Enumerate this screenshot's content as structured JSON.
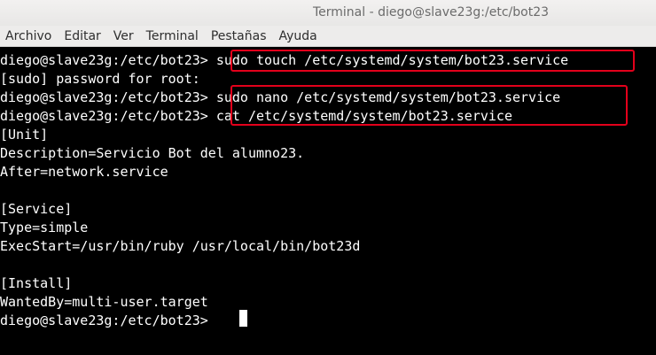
{
  "window": {
    "title": "Terminal - diego@slave23g:/etc/bot23"
  },
  "menubar": {
    "items": [
      "Archivo",
      "Editar",
      "Ver",
      "Terminal",
      "Pestañas",
      "Ayuda"
    ]
  },
  "terminal": {
    "prompt": "diego@slave23g:/etc/bot23>",
    "commands": {
      "touch": " sudo touch /etc/systemd/system/bot23.service",
      "nano": " sudo nano /etc/systemd/system/bot23.service",
      "cat": " cat /etc/systemd/system/bot23.service"
    },
    "sudo_prompt": "[sudo] password for root:",
    "output": {
      "unit_header": "[Unit]",
      "description": "Description=Servicio Bot del alumno23.",
      "after": "After=network.service",
      "service_header": "[Service]",
      "type": "Type=simple",
      "exec_start": "ExecStart=/usr/bin/ruby /usr/local/bin/bot23d",
      "install_header": "[Install]",
      "wanted_by": "WantedBy=multi-user.target"
    }
  },
  "colors": {
    "highlight": "#e3001b",
    "terminal_bg": "#000000",
    "terminal_fg": "#ffffff"
  }
}
